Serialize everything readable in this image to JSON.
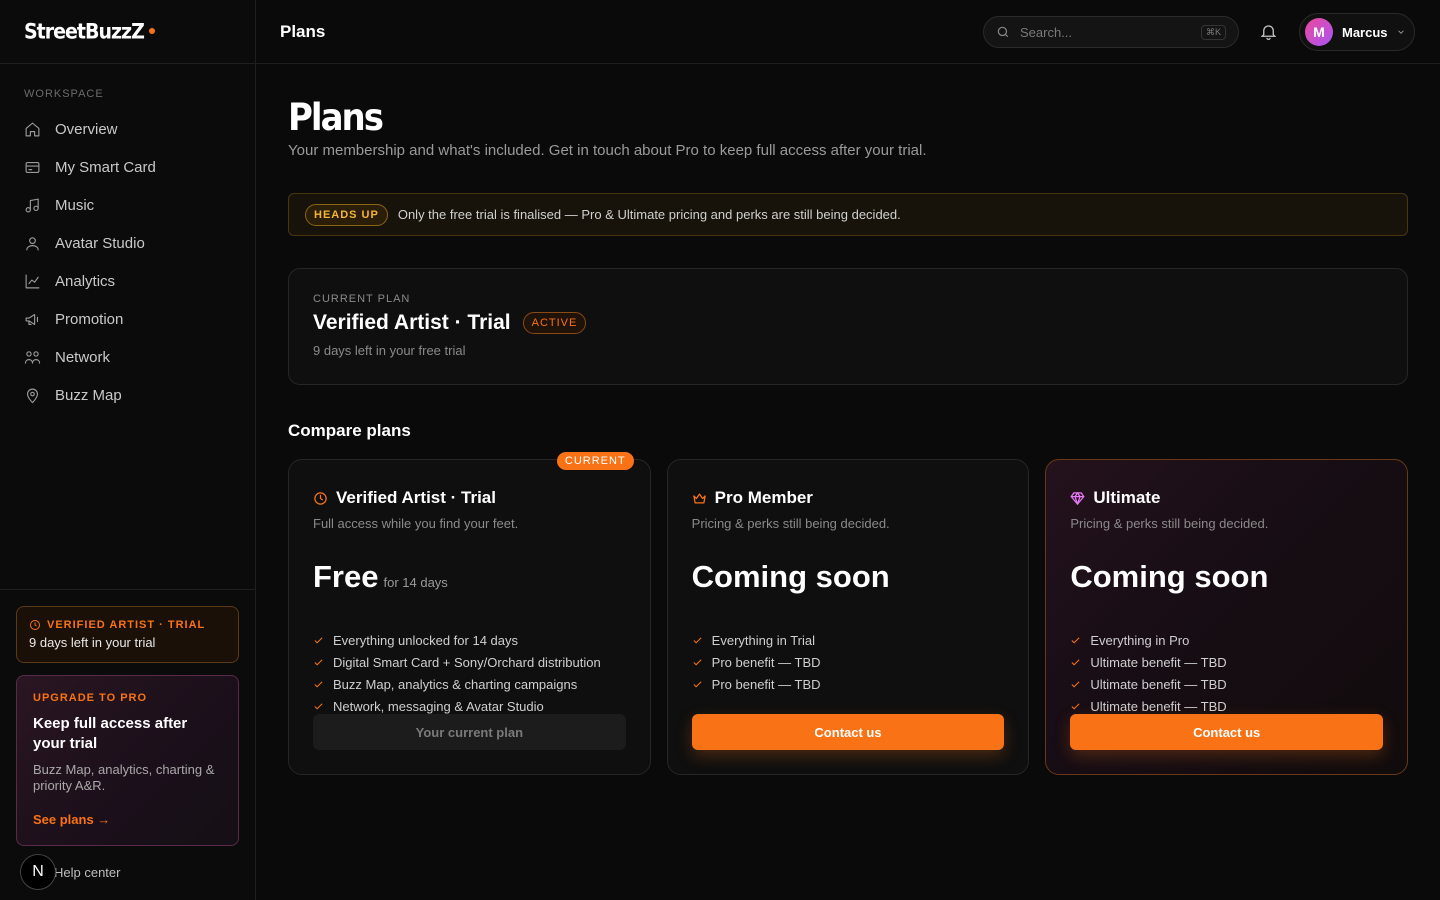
{
  "brand": {
    "name": "StreetBuzzZ"
  },
  "sidebar": {
    "heading": "WORKSPACE",
    "items": [
      {
        "label": "Overview",
        "icon": "home-icon"
      },
      {
        "label": "My Smart Card",
        "icon": "card-icon"
      },
      {
        "label": "Music",
        "icon": "music-icon"
      },
      {
        "label": "Avatar Studio",
        "icon": "user-icon"
      },
      {
        "label": "Analytics",
        "icon": "chart-icon"
      },
      {
        "label": "Promotion",
        "icon": "megaphone-icon"
      },
      {
        "label": "Network",
        "icon": "network-icon"
      },
      {
        "label": "Buzz Map",
        "icon": "map-pin-icon"
      }
    ],
    "trial": {
      "label": "VERIFIED ARTIST · TRIAL",
      "days": "9 days left in your trial"
    },
    "upgrade": {
      "label": "UPGRADE TO PRO",
      "title": "Keep full access after your trial",
      "desc": "Buzz Map, analytics, charting & priority A&R.",
      "link": "See plans →"
    },
    "help": "Help center",
    "badge": "N"
  },
  "topbar": {
    "title": "Plans",
    "search_placeholder": "Search...",
    "shortcut": "⌘K",
    "user": {
      "initial": "M",
      "name": "Marcus"
    }
  },
  "page": {
    "title": "Plans",
    "subtitle": "Your membership and what's included. Get in touch about Pro to keep full access after your trial.",
    "notice": {
      "badge": "HEADS UP",
      "text": "Only the free trial is finalised — Pro & Ultimate pricing and perks are still being decided."
    },
    "current": {
      "label": "CURRENT PLAN",
      "title": "Verified Artist · Trial",
      "status": "ACTIVE",
      "sub": "9 days left in your free trial"
    },
    "compare_title": "Compare plans",
    "plans": [
      {
        "tag": "CURRENT",
        "name": "Verified Artist · Trial",
        "desc": "Full access while you find your feet.",
        "price": "Free",
        "price_sub": "for 14 days",
        "features": [
          "Everything unlocked for 14 days",
          "Digital Smart Card + Sony/Orchard distribution",
          "Buzz Map, analytics & charting campaigns",
          "Network, messaging & Avatar Studio"
        ],
        "button": "Your current plan",
        "icon": "clock-icon",
        "icon_color": "#f97316"
      },
      {
        "name": "Pro Member",
        "desc": "Pricing & perks still being decided.",
        "price": "Coming soon",
        "features": [
          "Everything in Trial",
          "Pro benefit — TBD",
          "Pro benefit — TBD"
        ],
        "button": "Contact us",
        "icon": "crown-icon",
        "icon_color": "#f97316"
      },
      {
        "name": "Ultimate",
        "desc": "Pricing & perks still being decided.",
        "price": "Coming soon",
        "features": [
          "Everything in Pro",
          "Ultimate benefit — TBD",
          "Ultimate benefit — TBD",
          "Ultimate benefit — TBD"
        ],
        "button": "Contact us",
        "icon": "diamond-icon",
        "icon_color": "#e879f9"
      }
    ]
  },
  "colors": {
    "accent": "#f97316",
    "background": "#0a0a0a"
  }
}
